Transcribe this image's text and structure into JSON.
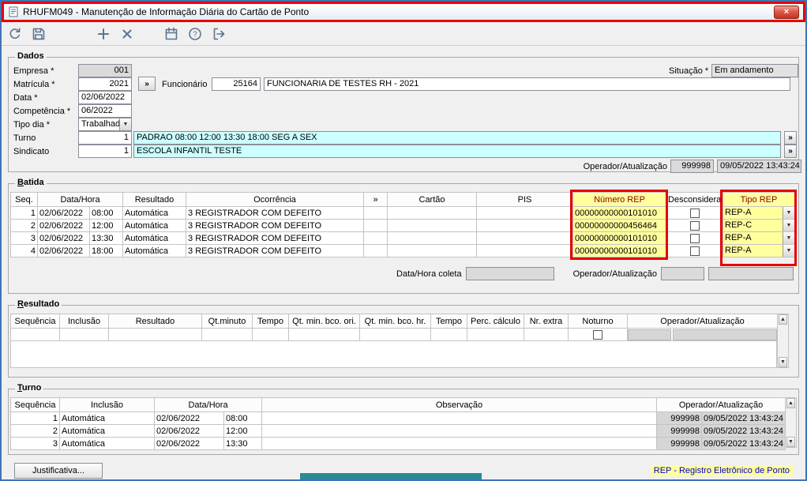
{
  "window": {
    "title": "RHUFM049 - Manutenção de Informação Diária do Cartão de Ponto"
  },
  "glyphs": {
    "close": "×",
    "double_chevron": "»",
    "dropdown_arrow": "▼",
    "up_arrow": "▲",
    "down_arrow": "▼"
  },
  "colors": {
    "annotation_red": "#e60000",
    "highlight_yellow": "#ffff9e",
    "field_cyan": "#ccffff",
    "note_blue": "#0000cc"
  },
  "toolbar": {
    "buttons": [
      "refresh",
      "save",
      "add",
      "delete",
      "calendar",
      "help",
      "exit"
    ]
  },
  "dados": {
    "legend": "Dados",
    "empresa_label": "Empresa *",
    "empresa": "001",
    "matricula_label": "Matrícula *",
    "matricula": "2021",
    "data_label": "Data *",
    "data": "02/06/2022",
    "competencia_label": "Competência *",
    "competencia": "06/2022",
    "tipo_dia_label": "Tipo dia *",
    "tipo_dia": "Trabalhad",
    "turno_label": "Turno",
    "turno": "1",
    "turno_desc": "PADRAO 08:00 12:00 13:30 18:00 SEG A SEX",
    "sindicato_label": "Sindicato",
    "sindicato": "1",
    "sindicato_desc": "ESCOLA INFANTIL TESTE",
    "funcionario_label": "Funcionário",
    "funcionario": "25164",
    "funcionario_nome": "FUNCIONARIA DE TESTES RH - 2021",
    "situacao_label": "Situação *",
    "situacao": "Em andamento",
    "operador_label": "Operador/Atualização",
    "operador": "999998",
    "atualizacao": "09/05/2022 13:43:24"
  },
  "batida": {
    "legend": "Batida",
    "headers": [
      "Seq.",
      "Data/Hora",
      "Resultado",
      "Ocorrência",
      "»",
      "Cartão",
      "PIS",
      "Número REP",
      "Desconsiderar",
      "Tipo REP"
    ],
    "rows": [
      {
        "seq": "1",
        "data": "02/06/2022",
        "hora": "08:00",
        "resultado": "Automática",
        "ocorrencia": "3 REGISTRADOR COM DEFEITO",
        "cartao": "",
        "pis": "",
        "numero_rep": "00000000000101010",
        "desconsiderar": false,
        "tipo_rep": "REP-A"
      },
      {
        "seq": "2",
        "data": "02/06/2022",
        "hora": "12:00",
        "resultado": "Automática",
        "ocorrencia": "3 REGISTRADOR COM DEFEITO",
        "cartao": "",
        "pis": "",
        "numero_rep": "00000000000456464",
        "desconsiderar": false,
        "tipo_rep": "REP-C"
      },
      {
        "seq": "3",
        "data": "02/06/2022",
        "hora": "13:30",
        "resultado": "Automática",
        "ocorrencia": "3 REGISTRADOR COM DEFEITO",
        "cartao": "",
        "pis": "",
        "numero_rep": "00000000000101010",
        "desconsiderar": false,
        "tipo_rep": "REP-A"
      },
      {
        "seq": "4",
        "data": "02/06/2022",
        "hora": "18:00",
        "resultado": "Automática",
        "ocorrencia": "3 REGISTRADOR COM DEFEITO",
        "cartao": "",
        "pis": "",
        "numero_rep": "00000000000101010",
        "desconsiderar": false,
        "tipo_rep": "REP-A"
      }
    ],
    "footer": {
      "data_hora_coleta_label": "Data/Hora coleta",
      "operador_label": "Operador/Atualização"
    }
  },
  "resultado": {
    "legend": "Resultado",
    "headers": [
      "Sequência",
      "Inclusão",
      "Resultado",
      "Qt.minuto",
      "Tempo",
      "Qt. min. bco. ori.",
      "Qt. min. bco. hr.",
      "Tempo",
      "Perc. cálculo",
      "Nr. extra",
      "Noturno",
      "Operador/Atualização"
    ]
  },
  "turno": {
    "legend": "Turno",
    "headers": [
      "Sequência",
      "Inclusão",
      "Data/Hora",
      "Observação",
      "Operador/Atualização"
    ],
    "rows": [
      {
        "seq": "1",
        "inclusao": "Automática",
        "data": "02/06/2022",
        "hora": "08:00",
        "observacao": "",
        "operador": "999998",
        "atualizacao": "09/05/2022 13:43:24"
      },
      {
        "seq": "2",
        "inclusao": "Automática",
        "data": "02/06/2022",
        "hora": "12:00",
        "observacao": "",
        "operador": "999998",
        "atualizacao": "09/05/2022 13:43:24"
      },
      {
        "seq": "3",
        "inclusao": "Automática",
        "data": "02/06/2022",
        "hora": "13:30",
        "observacao": "",
        "operador": "999998",
        "atualizacao": "09/05/2022 13:43:24"
      }
    ]
  },
  "footer": {
    "justificativa_button": "Justificativa...",
    "rep_note": "REP - Registro Eletrônico de Ponto"
  }
}
